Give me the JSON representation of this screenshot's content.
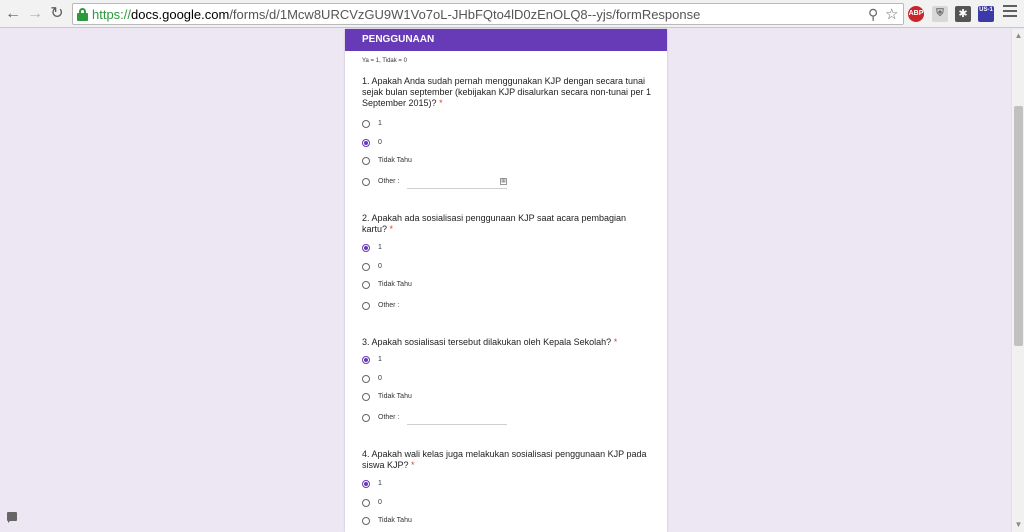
{
  "browser": {
    "url_proto": "https://",
    "url_host": "docs.google.com",
    "url_path": "/forms/d/1Mcw8URCVzGU9W1Vo7oL-JHbFQto4lD0zEnOLQ8--yjs/formResponse",
    "extensions": {
      "abp": "ABP",
      "us1": "US-1"
    }
  },
  "form": {
    "section_title": "PENGGUNAAN",
    "scale_note": "Ya = 1, Tidak  = 0",
    "questions": [
      {
        "text": "1. Apakah Anda sudah pernah menggunakan KJP dengan secara tunai sejak bulan september (kebijakan KJP disalurkan secara non-tunai per 1 September 2015)?",
        "required_mark": "*",
        "options": [
          "1",
          "0",
          "Tidak Tahu",
          "Other :"
        ],
        "selected": "0"
      },
      {
        "text": "2. Apakah ada sosialisasi penggunaan KJP saat acara pembagian kartu?",
        "required_mark": "*",
        "options": [
          "1",
          "0",
          "Tidak Tahu",
          "Other :"
        ],
        "selected": "1"
      },
      {
        "text": "3. Apakah sosialisasi tersebut dilakukan oleh Kepala Sekolah?",
        "required_mark": "*",
        "options": [
          "1",
          "0",
          "Tidak Tahu",
          "Other :"
        ],
        "selected": "1"
      },
      {
        "text": "4. Apakah wali kelas juga melakukan sosialisasi penggunaan KJP pada siswa KJP?",
        "required_mark": "*",
        "options": [
          "1",
          "0",
          "Tidak Tahu"
        ],
        "selected": "1"
      }
    ]
  },
  "icons": {
    "back": "back-arrow-icon",
    "forward": "forward-arrow-icon",
    "reload": "reload-icon",
    "lock": "lock-icon",
    "zoom": "zoom-icon",
    "bookmark": "star-icon",
    "menu": "hamburger-menu-icon",
    "feedback": "feedback-icon"
  }
}
